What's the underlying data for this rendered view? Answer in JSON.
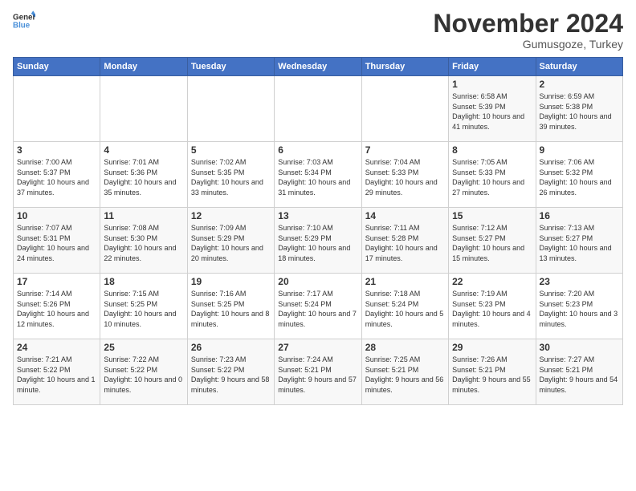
{
  "logo": {
    "line1": "General",
    "line2": "Blue"
  },
  "header": {
    "month": "November 2024",
    "location": "Gumusgoze, Turkey"
  },
  "weekdays": [
    "Sunday",
    "Monday",
    "Tuesday",
    "Wednesday",
    "Thursday",
    "Friday",
    "Saturday"
  ],
  "weeks": [
    [
      {
        "day": "",
        "info": ""
      },
      {
        "day": "",
        "info": ""
      },
      {
        "day": "",
        "info": ""
      },
      {
        "day": "",
        "info": ""
      },
      {
        "day": "",
        "info": ""
      },
      {
        "day": "1",
        "info": "Sunrise: 6:58 AM\nSunset: 5:39 PM\nDaylight: 10 hours and 41 minutes."
      },
      {
        "day": "2",
        "info": "Sunrise: 6:59 AM\nSunset: 5:38 PM\nDaylight: 10 hours and 39 minutes."
      }
    ],
    [
      {
        "day": "3",
        "info": "Sunrise: 7:00 AM\nSunset: 5:37 PM\nDaylight: 10 hours and 37 minutes."
      },
      {
        "day": "4",
        "info": "Sunrise: 7:01 AM\nSunset: 5:36 PM\nDaylight: 10 hours and 35 minutes."
      },
      {
        "day": "5",
        "info": "Sunrise: 7:02 AM\nSunset: 5:35 PM\nDaylight: 10 hours and 33 minutes."
      },
      {
        "day": "6",
        "info": "Sunrise: 7:03 AM\nSunset: 5:34 PM\nDaylight: 10 hours and 31 minutes."
      },
      {
        "day": "7",
        "info": "Sunrise: 7:04 AM\nSunset: 5:33 PM\nDaylight: 10 hours and 29 minutes."
      },
      {
        "day": "8",
        "info": "Sunrise: 7:05 AM\nSunset: 5:33 PM\nDaylight: 10 hours and 27 minutes."
      },
      {
        "day": "9",
        "info": "Sunrise: 7:06 AM\nSunset: 5:32 PM\nDaylight: 10 hours and 26 minutes."
      }
    ],
    [
      {
        "day": "10",
        "info": "Sunrise: 7:07 AM\nSunset: 5:31 PM\nDaylight: 10 hours and 24 minutes."
      },
      {
        "day": "11",
        "info": "Sunrise: 7:08 AM\nSunset: 5:30 PM\nDaylight: 10 hours and 22 minutes."
      },
      {
        "day": "12",
        "info": "Sunrise: 7:09 AM\nSunset: 5:29 PM\nDaylight: 10 hours and 20 minutes."
      },
      {
        "day": "13",
        "info": "Sunrise: 7:10 AM\nSunset: 5:29 PM\nDaylight: 10 hours and 18 minutes."
      },
      {
        "day": "14",
        "info": "Sunrise: 7:11 AM\nSunset: 5:28 PM\nDaylight: 10 hours and 17 minutes."
      },
      {
        "day": "15",
        "info": "Sunrise: 7:12 AM\nSunset: 5:27 PM\nDaylight: 10 hours and 15 minutes."
      },
      {
        "day": "16",
        "info": "Sunrise: 7:13 AM\nSunset: 5:27 PM\nDaylight: 10 hours and 13 minutes."
      }
    ],
    [
      {
        "day": "17",
        "info": "Sunrise: 7:14 AM\nSunset: 5:26 PM\nDaylight: 10 hours and 12 minutes."
      },
      {
        "day": "18",
        "info": "Sunrise: 7:15 AM\nSunset: 5:25 PM\nDaylight: 10 hours and 10 minutes."
      },
      {
        "day": "19",
        "info": "Sunrise: 7:16 AM\nSunset: 5:25 PM\nDaylight: 10 hours and 8 minutes."
      },
      {
        "day": "20",
        "info": "Sunrise: 7:17 AM\nSunset: 5:24 PM\nDaylight: 10 hours and 7 minutes."
      },
      {
        "day": "21",
        "info": "Sunrise: 7:18 AM\nSunset: 5:24 PM\nDaylight: 10 hours and 5 minutes."
      },
      {
        "day": "22",
        "info": "Sunrise: 7:19 AM\nSunset: 5:23 PM\nDaylight: 10 hours and 4 minutes."
      },
      {
        "day": "23",
        "info": "Sunrise: 7:20 AM\nSunset: 5:23 PM\nDaylight: 10 hours and 3 minutes."
      }
    ],
    [
      {
        "day": "24",
        "info": "Sunrise: 7:21 AM\nSunset: 5:22 PM\nDaylight: 10 hours and 1 minute."
      },
      {
        "day": "25",
        "info": "Sunrise: 7:22 AM\nSunset: 5:22 PM\nDaylight: 10 hours and 0 minutes."
      },
      {
        "day": "26",
        "info": "Sunrise: 7:23 AM\nSunset: 5:22 PM\nDaylight: 9 hours and 58 minutes."
      },
      {
        "day": "27",
        "info": "Sunrise: 7:24 AM\nSunset: 5:21 PM\nDaylight: 9 hours and 57 minutes."
      },
      {
        "day": "28",
        "info": "Sunrise: 7:25 AM\nSunset: 5:21 PM\nDaylight: 9 hours and 56 minutes."
      },
      {
        "day": "29",
        "info": "Sunrise: 7:26 AM\nSunset: 5:21 PM\nDaylight: 9 hours and 55 minutes."
      },
      {
        "day": "30",
        "info": "Sunrise: 7:27 AM\nSunset: 5:21 PM\nDaylight: 9 hours and 54 minutes."
      }
    ]
  ]
}
